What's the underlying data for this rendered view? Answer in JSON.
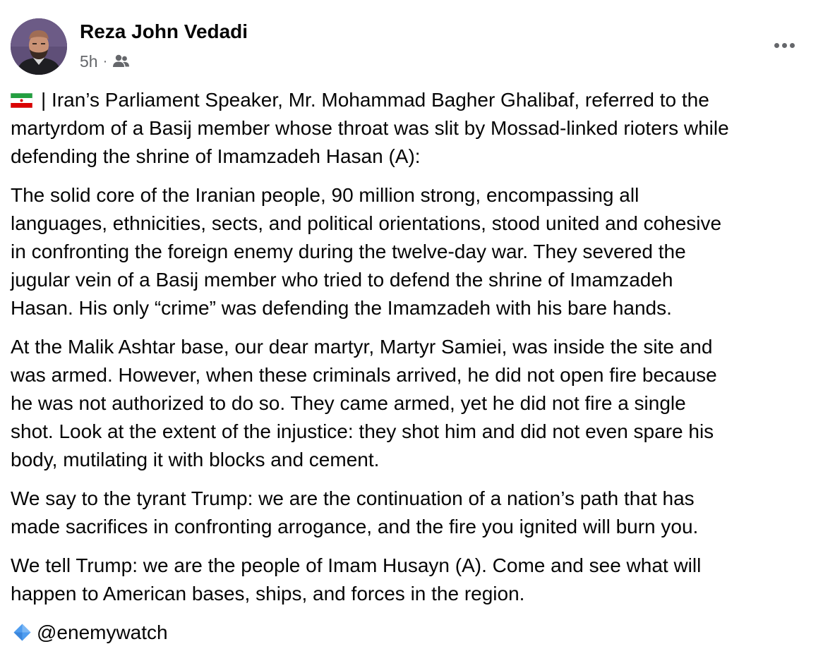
{
  "author": {
    "name": "Reza John Vedadi",
    "timestamp": "5h",
    "separator": "·",
    "audience_icon": "friends-icon"
  },
  "post": {
    "paragraphs": [
      {
        "lines": [
          "| Iran’s Parliament Speaker, Mr. Mohammad Bagher Ghalibaf, referred to the",
          "martyrdom of a Basij member whose throat was slit by Mossad-linked rioters while",
          "defending the shrine of Imamzadeh Hasan (A):"
        ]
      },
      {
        "lines": [
          "The solid core of the Iranian people, 90 million strong, encompassing all",
          "languages, ethnicities, sects, and political orientations, stood united and cohesive",
          "in confronting the foreign enemy during the twelve-day war. They severed the",
          "jugular vein of a Basij member who tried to defend the shrine of Imamzadeh",
          "Hasan. His only “crime” was defending the Imamzadeh with his bare hands."
        ]
      },
      {
        "lines": [
          "At the Malik Ashtar base, our dear martyr, Martyr Samiei, was inside the site and",
          "was armed. However, when these criminals arrived, he did not open fire because",
          "he was not authorized to do so. They came armed, yet he did not fire a single",
          "shot. Look at the extent of the injustice: they shot him and did not even spare his",
          "body, mutilating it with blocks and cement."
        ]
      },
      {
        "lines": [
          "We say to the tyrant Trump: we are the continuation of a nation’s path that has",
          "made sacrifices in confronting arrogance, and the fire you ignited will burn you."
        ]
      },
      {
        "lines": [
          "We tell Trump: we are the people of Imam Husayn (A). Come and see what will",
          "happen to American bases, ships, and forces in the region."
        ]
      }
    ],
    "signature": "@enemywatch",
    "flag_icon": "iran-flag-icon",
    "signature_icon": "blue-diamond-icon"
  },
  "colors": {
    "text": "#050505",
    "secondary_text": "#65676b",
    "diamond": "#4f9df0"
  }
}
